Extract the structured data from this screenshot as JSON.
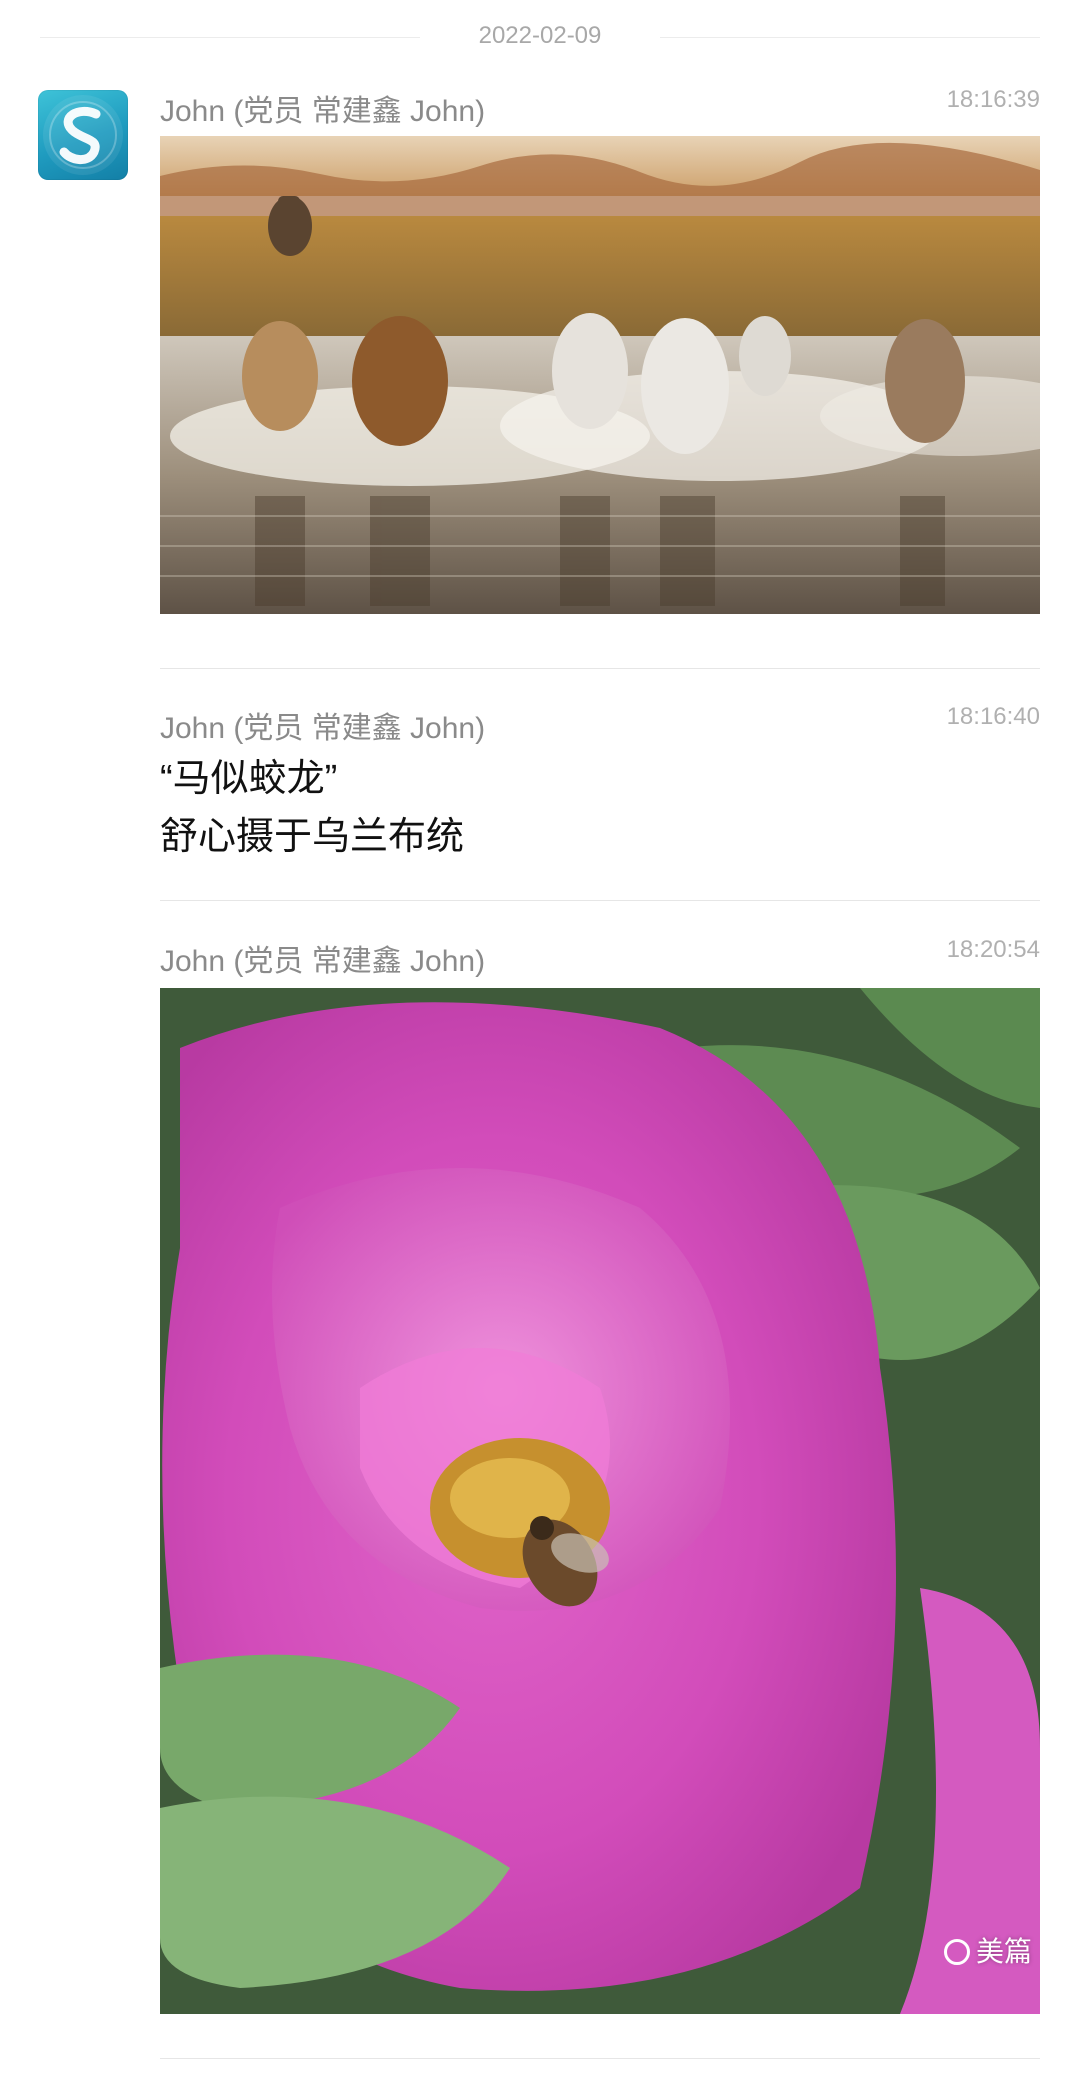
{
  "date_separator": "2022-02-09",
  "messages": [
    {
      "sender": "John (党员 常建鑫 John)",
      "time": "18:16:39",
      "type": "image",
      "image_desc": "horses running through water"
    },
    {
      "sender": "John (党员 常建鑫 John)",
      "time": "18:16:40",
      "type": "text",
      "lines": [
        "“马似蛟龙”",
        "舒心摄于乌兰布统"
      ]
    },
    {
      "sender": "John (党员 常建鑫 John)",
      "time": "18:20:54",
      "type": "image",
      "image_desc": "pink peony with bee"
    }
  ],
  "watermark": {
    "label": "美篇"
  },
  "colors": {
    "meta_text": "#8a8a8a",
    "time_text": "#b0b0b0",
    "divider": "#e6e6e6",
    "avatar": "#1f9bbf"
  },
  "icons": {
    "avatar": "app-logo-icon",
    "watermark": "meipian-logo-icon"
  }
}
